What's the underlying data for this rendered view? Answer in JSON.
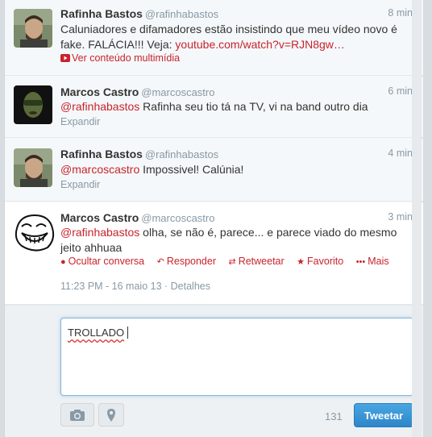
{
  "tweets": [
    {
      "name": "Rafinha Bastos",
      "handle": "@rafinhabastos",
      "time": "8 min",
      "text": "Caluniadores e difamadores estão insistindo que meu vídeo novo é fake. FALÁCIA!!! Veja:",
      "link": "youtube.com/watch?v=RJN8gw…",
      "media_label": "Ver conteúdo multimídia"
    },
    {
      "name": "Marcos Castro",
      "handle": "@marcoscastro",
      "time": "6 min",
      "mention": "@rafinhabastos",
      "text": "Rafinha seu tio tá na TV, vi na band outro dia",
      "expand": "Expandir"
    },
    {
      "name": "Rafinha Bastos",
      "handle": "@rafinhabastos",
      "time": "4 min",
      "mention": "@marcoscastro",
      "text": "Impossivel! Calúnia!",
      "expand": "Expandir"
    },
    {
      "name": "Marcos Castro",
      "handle": "@marcoscastro",
      "time": "3 min",
      "mention": "@rafinhabastos",
      "text_line1": "olha, se não é, parece... e parece viado do mesmo",
      "text_line2": "jeito ahhuaa",
      "actions": {
        "hide": "Ocultar conversa",
        "reply": "Responder",
        "retweet": "Retweetar",
        "favorite": "Favorito",
        "more": "Mais"
      },
      "timestamp": "11:23 PM - 16 maio 13",
      "details": "Detalhes"
    }
  ],
  "compose": {
    "text": "TROLLADO",
    "counter": "131",
    "tweet_button": "Tweetar",
    "icons": [
      "camera-icon",
      "location-pin-icon"
    ]
  },
  "colors": {
    "link": "#c8232c",
    "tweet_button": "#3a94d7",
    "muted": "#8899a6"
  }
}
